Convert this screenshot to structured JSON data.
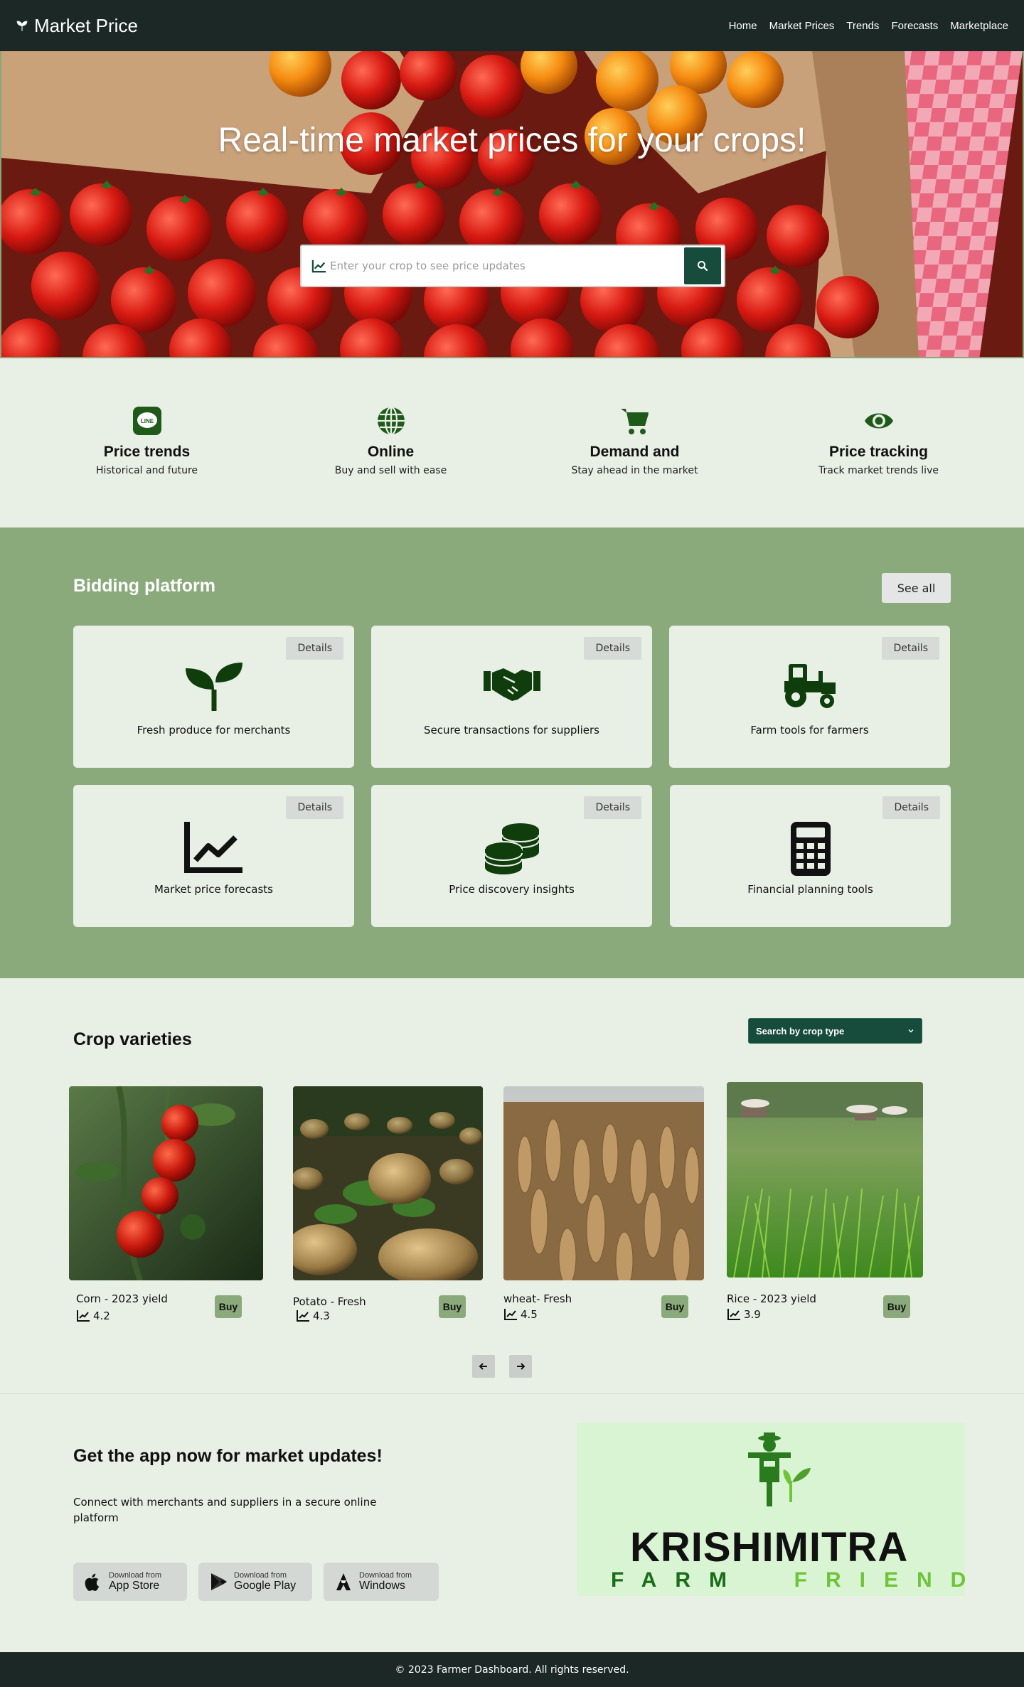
{
  "nav": {
    "brand": "Market Price",
    "links": [
      "Home",
      "Market Prices",
      "Trends",
      "Forecasts",
      "Marketplace"
    ]
  },
  "hero": {
    "title": "Real-time market prices for your crops!",
    "search_placeholder": "Enter your crop to see price updates"
  },
  "features": [
    {
      "icon": "line-app-icon",
      "title": "Price trends",
      "subtitle": "Historical and future"
    },
    {
      "icon": "globe-icon",
      "title": "Online",
      "subtitle": "Buy and sell with ease"
    },
    {
      "icon": "cart-icon",
      "title": "Demand and",
      "subtitle": "Stay ahead in the market"
    },
    {
      "icon": "eye-icon",
      "title": "Price tracking",
      "subtitle": "Track market trends live"
    }
  ],
  "bidding": {
    "title": "Bidding platform",
    "see_all": "See all",
    "details_label": "Details",
    "cards": [
      {
        "icon": "seedling-icon",
        "label": "Fresh produce for merchants"
      },
      {
        "icon": "handshake-icon",
        "label": "Secure transactions for suppliers"
      },
      {
        "icon": "tractor-icon",
        "label": "Farm tools for farmers"
      },
      {
        "icon": "chart-line-icon",
        "label": "Market price forecasts"
      },
      {
        "icon": "coins-icon",
        "label": "Price discovery insights"
      },
      {
        "icon": "calculator-icon",
        "label": "Financial planning tools"
      }
    ]
  },
  "crops": {
    "title": "Crop varieties",
    "select_label": "Search by crop type",
    "buy_label": "Buy",
    "items": [
      {
        "name": "Corn - 2023 yield",
        "rating": "4.2"
      },
      {
        "name": "Potato - Fresh",
        "rating": "4.3"
      },
      {
        "name": "wheat- Fresh",
        "rating": "4.5"
      },
      {
        "name": "Rice - 2023 yield",
        "rating": "3.9"
      }
    ]
  },
  "app": {
    "title": "Get the app now for market updates!",
    "description": "Connect with merchants and suppliers in a secure online platform",
    "stores": [
      {
        "small": "Download from",
        "big": "App Store"
      },
      {
        "small": "Download from",
        "big": "Google Play"
      },
      {
        "small": "Download from",
        "big": "Windows"
      }
    ],
    "logo": {
      "word1": "KRISHIMITRA",
      "farm": "FARM",
      "friend": "FRIEND"
    }
  },
  "footer": {
    "text": "© 2023 Farmer Dashboard. All rights reserved."
  }
}
